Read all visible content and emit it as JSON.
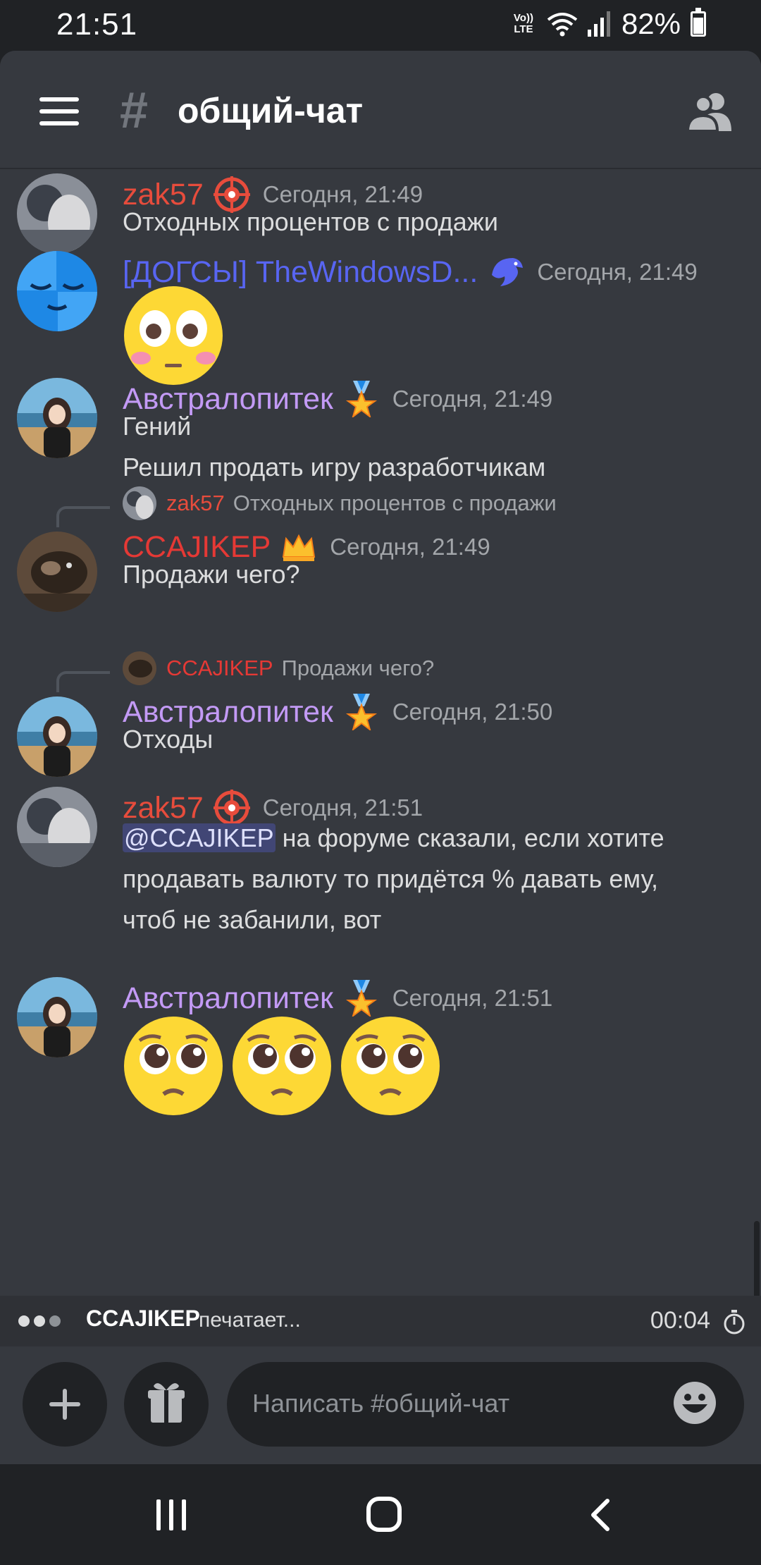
{
  "status_bar": {
    "time": "21:51",
    "volte": "Vo)) LTE",
    "battery": "82%"
  },
  "header": {
    "hash": "#",
    "title": "общий-чат"
  },
  "messages": [
    {
      "id": "m1",
      "username": "zak57",
      "name_color": "#e74c3c",
      "badge": "target-icon",
      "timestamp": "Сегодня, 21:49",
      "lines": [
        "Отходных процентов с продажи"
      ]
    },
    {
      "id": "m2",
      "username": "[ДОГСЫ] TheWindowsD...",
      "name_color": "#5865f2",
      "badge": "eagle-icon",
      "timestamp": "Сегодня, 21:49",
      "emoji": [
        "flushed-emoji"
      ]
    },
    {
      "id": "m3",
      "username": "Австралопитек",
      "name_color": "#c39af5",
      "badge": "medal-icon",
      "timestamp": "Сегодня, 21:49",
      "lines": [
        "Гений",
        "Решил продать игру разработчикам"
      ]
    },
    {
      "id": "m4",
      "reply": {
        "username": "zak57",
        "name_color": "#e74c3c",
        "text": "Отходных процентов с продажи"
      },
      "username": "CCAJIKEP",
      "name_color": "#e53935",
      "badge": "crown-icon",
      "timestamp": "Сегодня, 21:49",
      "lines": [
        "Продажи чего?"
      ]
    },
    {
      "id": "m5",
      "reply": {
        "username": "CCAJIKEP",
        "name_color": "#e53935",
        "text": "Продажи чего?"
      },
      "username": "Австралопитек",
      "name_color": "#c39af5",
      "badge": "medal-icon",
      "timestamp": "Сегодня, 21:50",
      "lines": [
        "Отходы"
      ]
    },
    {
      "id": "m6",
      "username": "zak57",
      "name_color": "#e74c3c",
      "badge": "target-icon",
      "timestamp": "Сегодня, 21:51",
      "mention": "@CCAJIKEP",
      "lines": [
        " на форуме сказали, если хотите",
        "продавать валюту то придётся % давать ему,",
        "чтоб не забанили, вот"
      ]
    },
    {
      "id": "m7",
      "username": "Австралопитек",
      "name_color": "#c39af5",
      "badge": "medal-icon",
      "timestamp": "Сегодня, 21:51",
      "emoji": [
        "pleading-emoji",
        "pleading-emoji",
        "pleading-emoji"
      ]
    }
  ],
  "typing": {
    "user": "CCAJIKEP",
    "label": "печатает...",
    "elapsed": "00:04"
  },
  "composer": {
    "placeholder": "Написать #общий-чат"
  },
  "colors": {
    "background": "#36393f",
    "dark": "#202225",
    "mention_bg": "#414675"
  }
}
